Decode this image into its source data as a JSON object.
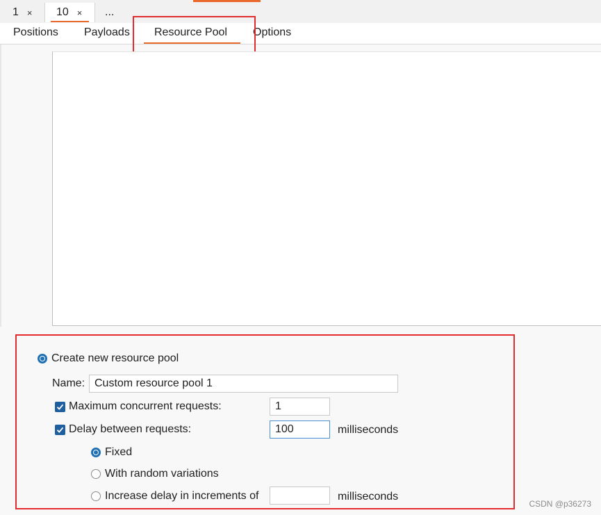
{
  "instance_tabs": [
    {
      "label": "1",
      "close": "×"
    },
    {
      "label": "10",
      "close": "×"
    },
    {
      "label": "..."
    }
  ],
  "sub_tabs": [
    "Positions",
    "Payloads",
    "Resource Pool",
    "Options"
  ],
  "active_sub_tab": "Resource Pool",
  "pool": {
    "create_new_label": "Create new resource pool",
    "name_label": "Name:",
    "name_value": "Custom resource pool 1",
    "max_concurrent_label": "Maximum concurrent requests:",
    "max_concurrent_value": "1",
    "delay_label": "Delay between requests:",
    "delay_value": "100",
    "delay_unit": "milliseconds",
    "fixed_label": "Fixed",
    "random_label": "With random variations",
    "increase_label": "Increase delay in increments of",
    "increase_value": "",
    "increase_unit": "milliseconds"
  },
  "watermark": "CSDN @p36273",
  "colors": {
    "accent": "#e9692c",
    "highlight": "#e32a2f",
    "checkbox": "#1f5f9e",
    "radio": "#1f6fb5"
  }
}
